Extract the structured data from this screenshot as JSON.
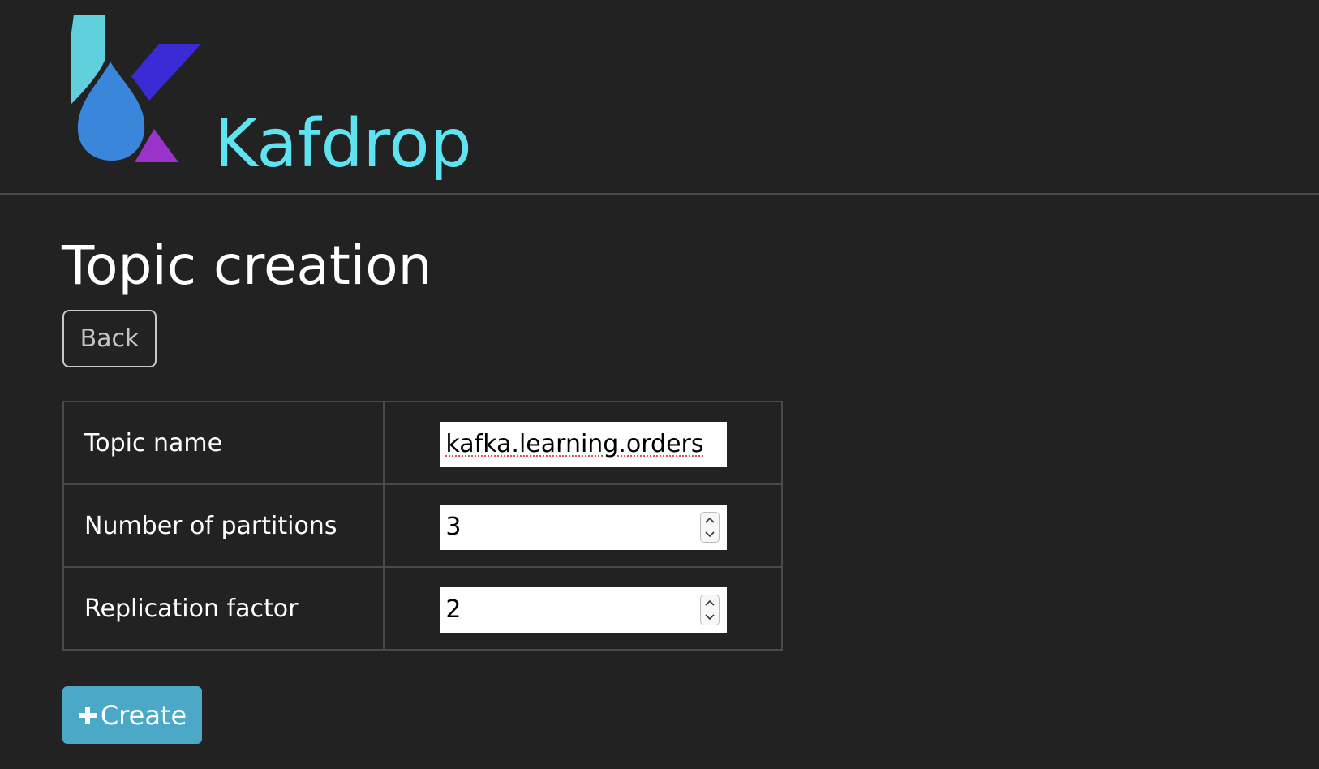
{
  "header": {
    "brand_name": "Kafdrop",
    "logo_icon": "kafdrop-logo",
    "brand_color": "#5fe3f0"
  },
  "main": {
    "title": "Topic creation",
    "back_label": "Back",
    "form": {
      "rows": [
        {
          "label": "Topic name",
          "value": "kafka.learning.orders",
          "type": "text"
        },
        {
          "label": "Number of partitions",
          "value": "3",
          "type": "number"
        },
        {
          "label": "Replication factor",
          "value": "2",
          "type": "number"
        }
      ]
    },
    "create_label": "Create",
    "create_icon": "plus-icon",
    "create_color": "#4ba8c7"
  }
}
